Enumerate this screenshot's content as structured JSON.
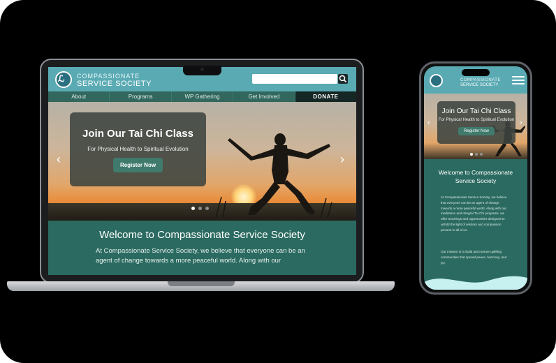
{
  "site": {
    "name_line1": "COMPASSIONATE",
    "name_line2": "SERVICE SOCIETY",
    "logo_mark": "ℒ"
  },
  "nav": [
    {
      "label": "About"
    },
    {
      "label": "Programs"
    },
    {
      "label": "WP Gathering"
    },
    {
      "label": "Get Involved"
    },
    {
      "label": "DONATE"
    }
  ],
  "search": {
    "placeholder": "",
    "icon": "search-icon"
  },
  "hero": {
    "title": "Join Our Tai Chi Class",
    "subtitle": "For Physical Health to Spiritual Evolution",
    "cta": "Register Now",
    "prev_arrow": "‹",
    "next_arrow": "›",
    "slide_count": 3,
    "active_slide": 1
  },
  "welcome": {
    "title": "Welcome to Compassionate Service Society",
    "laptop_text": "At Compassionate Service Society, we believe that everyone can be an agent of change towards a more peaceful world. Along with our",
    "mobile_title": "Welcome to Compassionate Service Society",
    "mobile_text1": "At Compassionate Service Society, we believe that everyone can be an agent of change towards a more peaceful world. Along with our meditation and Integral Tai Chi programs, we offer teachings and opportunities designed to unfold the light of wisdom and compassion present in all of us.",
    "mobile_text2": "Our mission is to build and nurture uplifting communities that spread peace, harmony, and joy."
  },
  "colors": {
    "header_teal": "#5aaab3",
    "nav_green": "#31675c",
    "donate_bg": "#152724",
    "section_green": "#2b6a60",
    "button_green": "#3f7a6c"
  }
}
